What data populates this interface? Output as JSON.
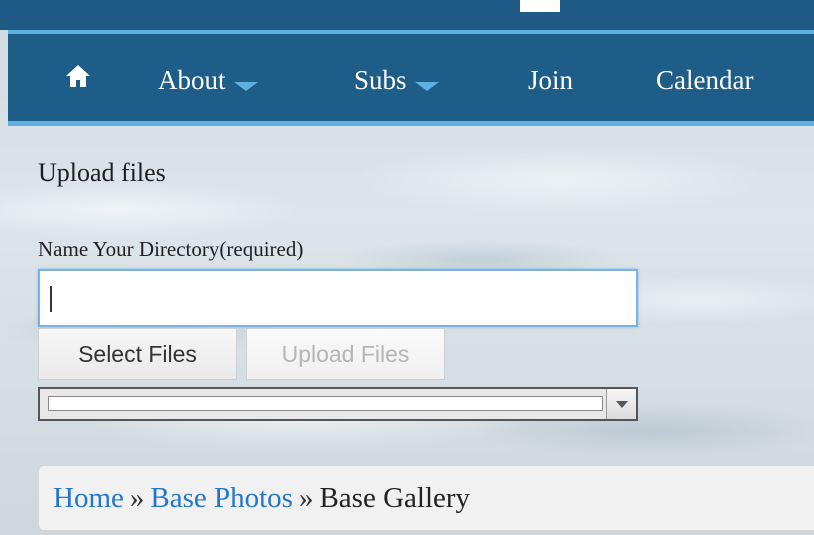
{
  "nav": {
    "items": [
      {
        "label": "About",
        "has_dropdown": true
      },
      {
        "label": "Subs",
        "has_dropdown": true
      },
      {
        "label": "Join",
        "has_dropdown": false
      },
      {
        "label": "Calendar",
        "has_dropdown": false
      }
    ],
    "home_icon": "home-icon",
    "colors": {
      "bar": "#1e5d87",
      "accent": "#5fb0e0"
    }
  },
  "upload": {
    "title": "Upload files",
    "directory_label": "Name Your Directory(required)",
    "directory_value": "",
    "select_button": "Select Files",
    "upload_button": "Upload Files",
    "dropdown_value": ""
  },
  "breadcrumb": {
    "items": [
      "Home",
      "Base Photos",
      "Base Gallery"
    ],
    "separator": "»",
    "link_color": "#2277cc"
  }
}
